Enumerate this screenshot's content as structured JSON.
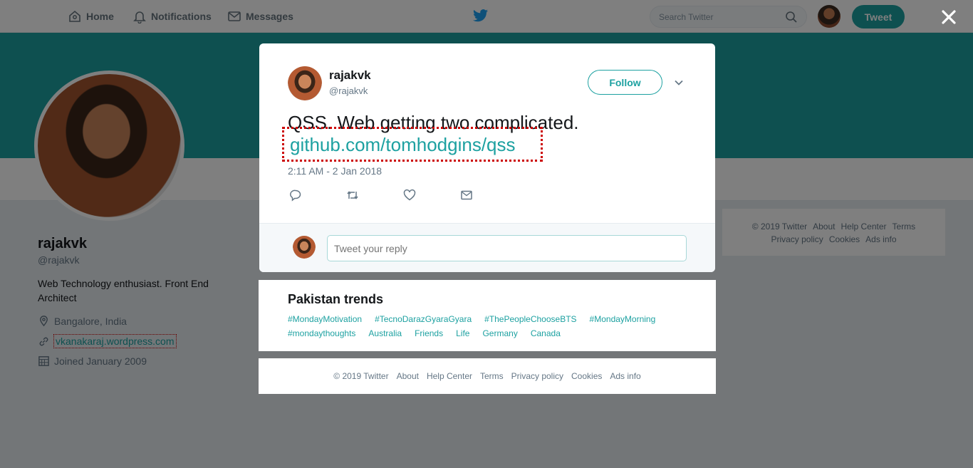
{
  "topnav": {
    "home_label": "Home",
    "notifications_label": "Notifications",
    "messages_label": "Messages",
    "search_placeholder": "Search Twitter",
    "tweet_button": "Tweet"
  },
  "profile": {
    "name": "rajakvk",
    "handle": "@rajakvk",
    "bio": "Web Technology enthusiast. Front End Architect",
    "location": "Bangalore, India",
    "website": "vkanakaraj.wordpress.com",
    "joined": "Joined January 2009"
  },
  "side_footer": {
    "links": [
      "© 2019 Twitter",
      "About",
      "Help Center",
      "Terms",
      "Privacy policy",
      "Cookies",
      "Ads info"
    ]
  },
  "tweet": {
    "name": "rajakvk",
    "handle": "@rajakvk",
    "follow_label": "Follow",
    "text": "QSS. Web getting two complicated.",
    "link": "github.com/tomhodgins/qss",
    "timestamp": "2:11 AM - 2 Jan 2018",
    "reply_placeholder": "Tweet your reply"
  },
  "trends": {
    "title": "Pakistan trends",
    "items": [
      "#MondayMotivation",
      "#TecnoDarazGyaraGyara",
      "#ThePeopleChooseBTS",
      "#MondayMorning",
      "#mondaythoughts",
      "Australia",
      "Friends",
      "Life",
      "Germany",
      "Canada"
    ]
  },
  "footer": {
    "links": [
      "© 2019 Twitter",
      "About",
      "Help Center",
      "Terms",
      "Privacy policy",
      "Cookies",
      "Ads info"
    ]
  },
  "colors": {
    "accent": "#1da1a1",
    "highlight_border": "#cc0000"
  }
}
